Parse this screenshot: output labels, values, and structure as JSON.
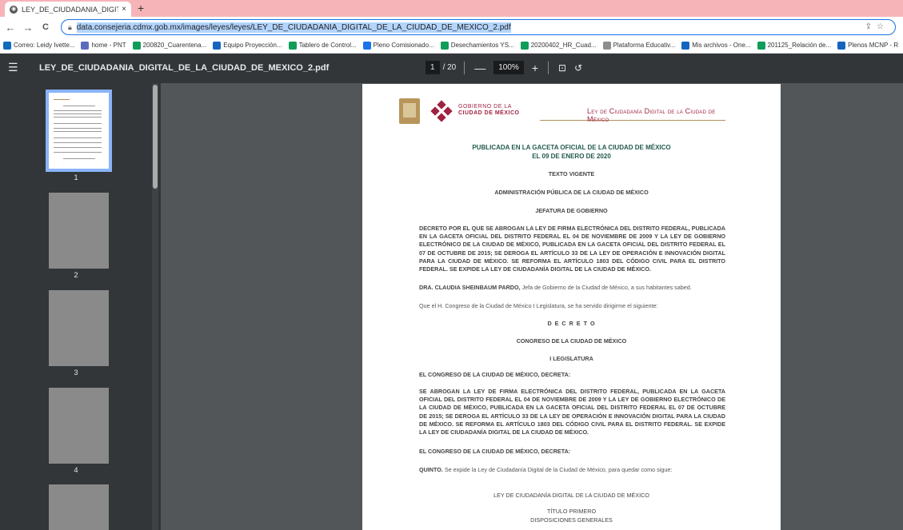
{
  "browser": {
    "tab_title": "LEY_DE_CIUDADANIA_DIGITAL_D",
    "tab_close": "×",
    "new_tab": "+",
    "url": "data.consejeria.cdmx.gob.mx/images/leyes/leyes/LEY_DE_CIUDADANIA_DIGITAL_DE_LA_CIUDAD_DE_MEXICO_2.pdf",
    "back": "←",
    "forward": "→",
    "reload": "C",
    "share_icon": "share-icon",
    "star_icon": "star-icon"
  },
  "bookmarks": [
    {
      "label": "Correo: Leidy Ivette...",
      "color": "#0f6cbd"
    },
    {
      "label": "home - PNT",
      "color": "#5c6bc0"
    },
    {
      "label": "200820_Cuarentena...",
      "color": "#0f9d58"
    },
    {
      "label": "Equipo Proyección...",
      "color": "#1565c0"
    },
    {
      "label": "Tablero de Control...",
      "color": "#0f9d58"
    },
    {
      "label": "Pleno Comisionado...",
      "color": "#1a73e8"
    },
    {
      "label": "Desechamientos YS...",
      "color": "#0f9d58"
    },
    {
      "label": "20200402_HR_Cuad...",
      "color": "#0f9d58"
    },
    {
      "label": "Plataforma Educativ...",
      "color": "#8e8e8e"
    },
    {
      "label": "Mis archivos - One...",
      "color": "#1565c0"
    },
    {
      "label": "201125_Relación de...",
      "color": "#0f9d58"
    },
    {
      "label": "Plenos MCNP - R",
      "color": "#1565c0"
    }
  ],
  "pdf": {
    "filename": "LEY_DE_CIUDADANIA_DIGITAL_DE_LA_CIUDAD_DE_MEXICO_2.pdf",
    "current_page": "1",
    "total_pages": "/ 20",
    "zoom_out": "—",
    "zoom": "100%",
    "zoom_in": "+"
  },
  "thumbnails": [
    "1",
    "2",
    "3",
    "4"
  ],
  "document": {
    "gob_line1": "GOBIERNO DE LA",
    "gob_line2": "CIUDAD DE MÉXICO",
    "header_title": "Ley de Ciudadanía Digital de la Ciudad de México",
    "pub1": "PUBLICADA EN LA GACETA OFICIAL DE LA CIUDAD DE MÉXICO",
    "pub2": "EL 09 DE ENERO DE 2020",
    "texto_vigente": "TEXTO VIGENTE",
    "administracion": "ADMINISTRACIÓN PÚBLICA DE LA CIUDAD DE MÉXICO",
    "jefatura": "JEFATURA DE GOBIERNO",
    "decreto_para": "DECRETO POR EL QUE SE ABROGAN LA LEY DE FIRMA ELECTRÓNICA DEL DISTRITO FEDERAL, PUBLICADA EN LA GACETA OFICIAL DEL DISTRITO FEDERAL EL 04 DE NOVIEMBRE DE 2009 Y LA LEY DE GOBIERNO ELECTRÓNICO DE LA CIUDAD DE MÉXICO, PUBLICADA EN LA GACETA OFICIAL DEL DISTRITO FEDERAL EL 07 DE OCTUBRE DE 2015; SE DEROGA EL ARTÍCULO 33 DE LA LEY DE OPERACIÓN E INNOVACIÓN DIGITAL PARA LA CIUDAD DE MÉXICO. SE REFORMA EL ARTÍCULO 1803 DEL CÓDIGO CIVIL PARA EL DISTRITO FEDERAL. SE EXPIDE LA LEY DE CIUDADANÍA DIGITAL DE LA CIUDAD DE MÉXICO.",
    "sheinbaum_bold": "DRA. CLAUDIA SHEINBAUM PARDO,",
    "sheinbaum_rest": " Jefa de Gobierno de la Ciudad de México, a sus habitantes sabed.",
    "congreso_line": "Que el H. Congreso de la Ciudad de México I Legislatura, se ha servido dirigirme el siguiente:",
    "decreto_word": "D E C R E T O",
    "congreso_cdmx": "CONGRESO DE LA CIUDAD DE MÉXICO",
    "legislatura": "I LEGISLATURA",
    "el_congreso_1": "EL CONGRESO DE LA CIUDAD DE MÉXICO, DECRETA:",
    "abrogan_para": "SE ABROGAN LA LEY DE FIRMA ELECTRÓNICA DEL DISTRITO FEDERAL, PUBLICADA EN LA GACETA OFICIAL DEL DISTRITO FEDERAL EL 04 DE NOVIEMBRE DE 2009 Y LA LEY DE GOBIERNO ELECTRÓNICO DE LA CIUDAD DE MÉXICO, PUBLICADA EN LA GACETA OFICIAL DEL DISTRITO FEDERAL EL 07 DE OCTUBRE DE 2015; SE DEROGA EL ARTÍCULO 33 DE LA LEY DE OPERACIÓN E INNOVACIÓN DIGITAL PARA LA CIUDAD DE MÉXICO. SE REFORMA EL ARTÍCULO 1803 DEL CÓDIGO CIVIL PARA EL DISTRITO FEDERAL. SE EXPIDE LA LEY DE CIUDADANÍA DIGITAL DE LA CIUDAD DE MÉXICO.",
    "el_congreso_2": "EL CONGRESO DE LA CIUDAD DE MÉXICO, DECRETA:",
    "quinto_bold": "QUINTO.",
    "quinto_rest": " Se expide la Ley de Ciudadanía Digital de la Ciudad de México, para quedar como sigue:",
    "ley_title": "LEY DE CIUDADANÍA DIGITAL DE LA CIUDAD DE MÉXICO",
    "titulo_primero": "TÍTULO PRIMERO",
    "disposiciones": "DISPOSICIONES GENERALES"
  }
}
